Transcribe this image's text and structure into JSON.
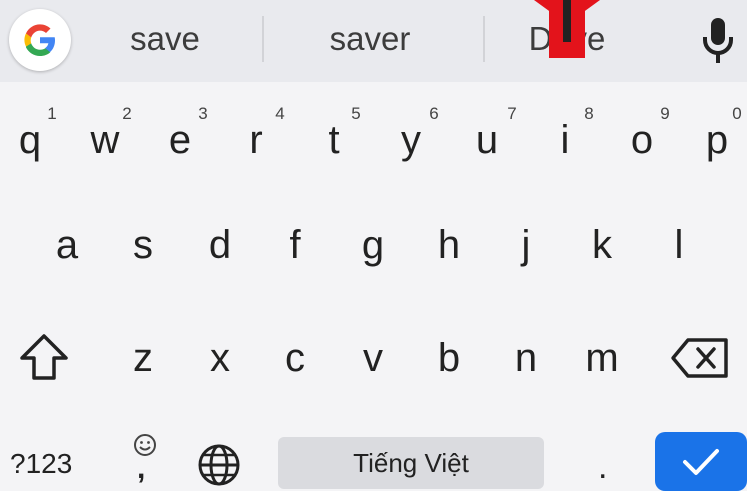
{
  "suggestions": {
    "items": [
      "save",
      "saver",
      "D",
      "ve"
    ]
  },
  "keyboard": {
    "row1": [
      {
        "key": "q",
        "hint": "1"
      },
      {
        "key": "w",
        "hint": "2"
      },
      {
        "key": "e",
        "hint": "3"
      },
      {
        "key": "r",
        "hint": "4"
      },
      {
        "key": "t",
        "hint": "5"
      },
      {
        "key": "y",
        "hint": "6"
      },
      {
        "key": "u",
        "hint": "7"
      },
      {
        "key": "i",
        "hint": "8"
      },
      {
        "key": "o",
        "hint": "9"
      },
      {
        "key": "p",
        "hint": "0"
      }
    ],
    "row2": [
      "a",
      "s",
      "d",
      "f",
      "g",
      "h",
      "j",
      "k",
      "l"
    ],
    "row3": [
      "z",
      "x",
      "c",
      "v",
      "b",
      "n",
      "m"
    ],
    "symbols_label": "?123",
    "comma": ",",
    "space_label": "Tiếng Việt",
    "period": "."
  },
  "icons": {
    "google": "google-g-icon",
    "mic": "microphone-icon",
    "shift": "shift-arrow-icon",
    "backspace": "backspace-icon",
    "emoji": "emoji-icon",
    "globe": "globe-icon",
    "enter": "checkmark-icon",
    "marker": "red-arrow-marker-icon"
  },
  "colors": {
    "keyboard_bg": "#f4f4f6",
    "suggestion_bar_bg": "#e9eaee",
    "enter_key": "#1a73e8",
    "marker": "#e3131b"
  }
}
